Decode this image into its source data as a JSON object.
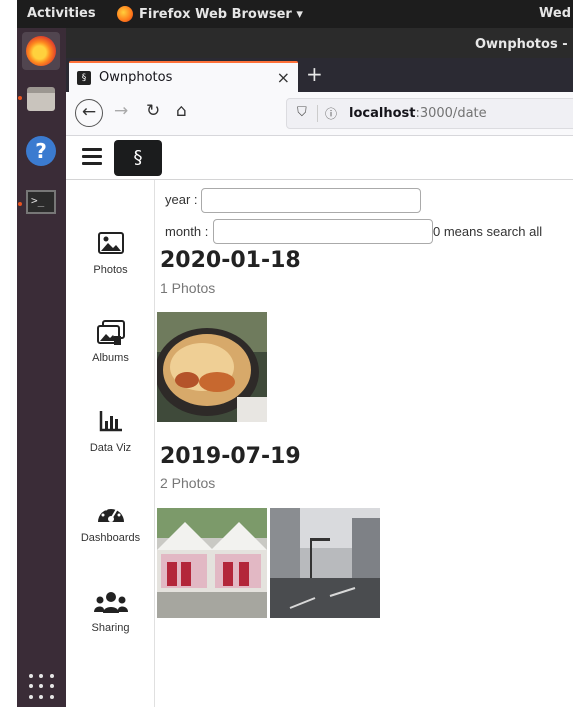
{
  "topbar": {
    "activities": "Activities",
    "app_name": "Firefox Web Browser ▾",
    "clock": "Wed"
  },
  "window": {
    "title": "Ownphotos -"
  },
  "browser": {
    "tab_title": "Ownphotos",
    "tab_close": "×",
    "new_tab": "+",
    "url_host": "localhost",
    "url_rest": ":3000/date"
  },
  "sidebar": {
    "items": [
      {
        "label": "Photos",
        "icon": "image-icon"
      },
      {
        "label": "Albums",
        "icon": "albums-icon"
      },
      {
        "label": "Data Viz",
        "icon": "bar-chart-icon"
      },
      {
        "label": "Dashboards",
        "icon": "dashboard-icon"
      },
      {
        "label": "Sharing",
        "icon": "users-icon"
      }
    ]
  },
  "filters": {
    "year_label": "year :",
    "year_value": "",
    "month_label": "month :",
    "month_value": "",
    "hint": "0 means search all"
  },
  "groups": [
    {
      "date": "2020-01-18",
      "count": "1 Photos"
    },
    {
      "date": "2019-07-19",
      "count": "2 Photos"
    }
  ],
  "colors": {
    "accent": "#ff7139",
    "dock_bg": "#3a2c37",
    "topbar_bg": "#1d1d1d"
  }
}
